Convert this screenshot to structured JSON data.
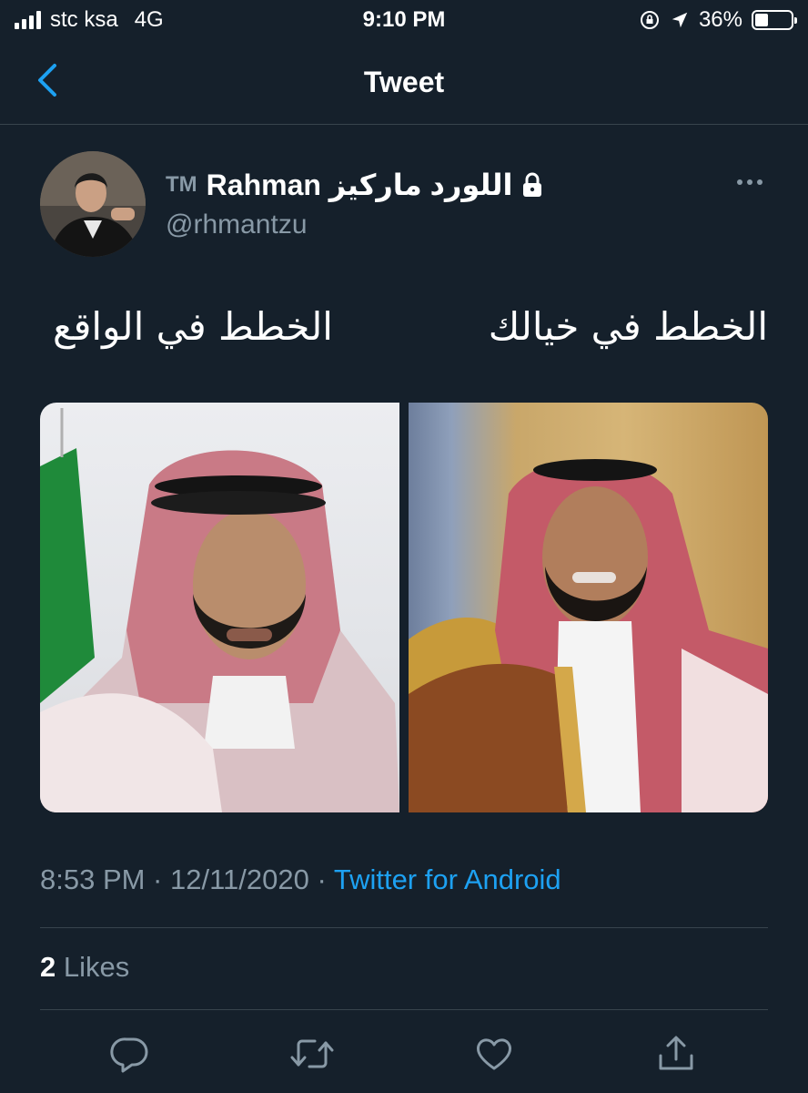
{
  "status_bar": {
    "carrier": "stc ksa",
    "network": "4G",
    "time": "9:10 PM",
    "battery_percent": "36%",
    "battery_level": 0.36
  },
  "nav": {
    "title": "Tweet",
    "back_icon": "chevron-left-icon"
  },
  "tweet": {
    "author": {
      "name_prefix": "TM",
      "name": "Rahman اللورد ماركيز",
      "handle": "@rhmantzu",
      "protected_icon": "lock-icon"
    },
    "text_right": "الخطط في خيالك",
    "text_left": "الخطط في الواقع",
    "timestamp": "8:53 PM · 12/11/2020 · ",
    "source": "Twitter for Android",
    "likes_count": "2",
    "likes_label": " Likes"
  },
  "actions": [
    "reply-icon",
    "retweet-icon",
    "like-icon",
    "share-icon"
  ],
  "colors": {
    "background": "#15202b",
    "accent": "#1da1f2",
    "secondary_text": "#8899a6",
    "divider": "#38444d"
  }
}
